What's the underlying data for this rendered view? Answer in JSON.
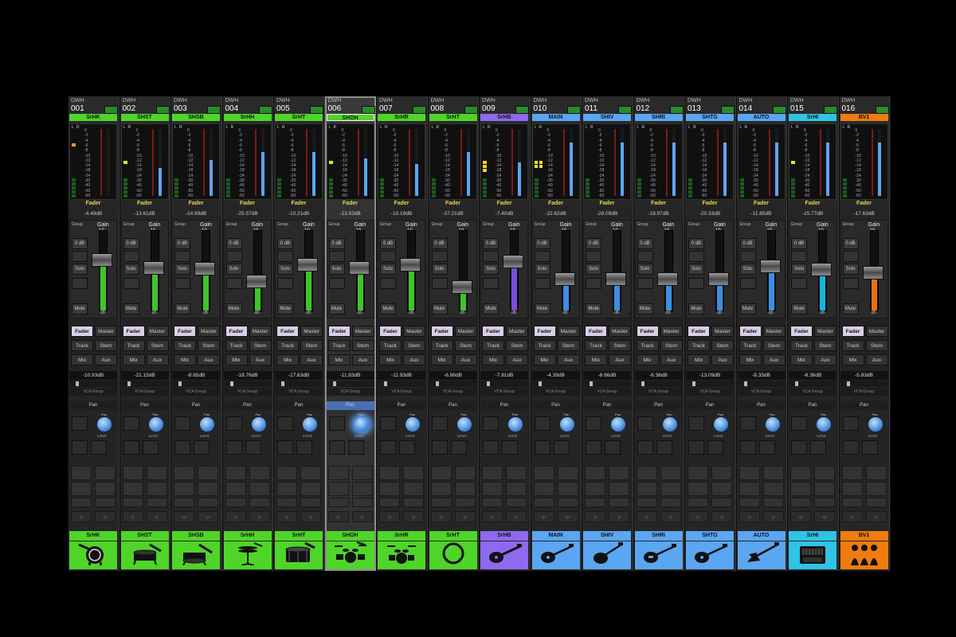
{
  "labels": {
    "dwh": "DWH",
    "fader": "Fader",
    "group": "Group",
    "gain": "Gain",
    "gain_scale_top": "10",
    "gain_scale_mark": "0",
    "zero_db": "0 dB",
    "solo": "Solo",
    "mute": "Mute",
    "db": "dB",
    "fader_btn": "Fader",
    "master_btn": "Master",
    "track_btn": "Track",
    "stem_btn": "Stem",
    "mix_btn": "Mix",
    "aux_btn": "Aux",
    "vca_group": "VCA Group",
    "pan": "Pan",
    "pan_knob_label": "Pan",
    "vpot": "V-POT",
    "meter_l": "L",
    "meter_r": "R",
    "scale": [
      "0",
      "-2",
      "-4",
      "-6",
      "-8",
      "-10",
      "-12",
      "-14",
      "-18",
      "-24",
      "-30",
      "-40",
      "-50",
      "-60"
    ]
  },
  "colors": {
    "green": "#4fd42a",
    "purple": "#8f69f0",
    "blue": "#5aa6f2",
    "cyan": "#2fc3e6",
    "orange": "#f07c10",
    "fill_green": "#3fc52a",
    "fill_purple": "#7a4de0",
    "fill_blue": "#3d8ee0",
    "fill_cyan": "#15b5dc",
    "fill_orange": "#e87010"
  },
  "channels": [
    {
      "num": "001",
      "name": "SrHK",
      "color": "green",
      "fader_db": "-4.49dB",
      "level": 0.64,
      "meter": 0.0,
      "peak": "orange",
      "mix_db": "-10.93dB",
      "icon": "kick-drum-icon"
    },
    {
      "num": "002",
      "name": "SHST",
      "color": "green",
      "fader_db": "-13.61dB",
      "level": 0.54,
      "meter": 0.42,
      "peak": "yellow",
      "mix_db": "-21.15dB",
      "icon": "snare-drum-icon"
    },
    {
      "num": "003",
      "name": "SHSB",
      "color": "green",
      "fader_db": "-14.99dB",
      "level": 0.53,
      "meter": 0.54,
      "peak": "",
      "mix_db": "-8.65dB",
      "icon": "snare-bottom-icon"
    },
    {
      "num": "004",
      "name": "SrHH",
      "color": "green",
      "fader_db": "-25.57dB",
      "level": 0.37,
      "meter": 0.66,
      "peak": "",
      "mix_db": "-18.76dB",
      "icon": "hihat-icon"
    },
    {
      "num": "005",
      "name": "SrHT",
      "color": "green",
      "fader_db": "-10.21dB",
      "level": 0.58,
      "meter": 0.66,
      "peak": "",
      "mix_db": "-17.63dB",
      "icon": "tom-drum-icon"
    },
    {
      "num": "006",
      "name": "SHOH",
      "color": "green",
      "fader_db": "-13.53dB",
      "level": 0.54,
      "meter": 0.56,
      "peak": "yellow",
      "mix_db": "-11.83dB",
      "icon": "drum-kit-icon",
      "selected": true
    },
    {
      "num": "007",
      "name": "SrHR",
      "color": "green",
      "fader_db": "-10.19dB",
      "level": 0.58,
      "meter": 0.48,
      "peak": "",
      "mix_db": "-11.93dB",
      "icon": "drum-kit-room-icon"
    },
    {
      "num": "008",
      "name": "SrHT",
      "color": "green",
      "fader_db": "-37.21dB",
      "level": 0.3,
      "meter": 0.66,
      "peak": "",
      "mix_db": "-6.86dB",
      "icon": "tambourine-icon"
    },
    {
      "num": "009",
      "name": "SrHB",
      "color": "purple",
      "fader_db": "-7.40dB",
      "level": 0.62,
      "meter": 0.5,
      "peak": "yellow2",
      "mix_db": "-7.81dB",
      "icon": "bass-guitar-icon"
    },
    {
      "num": "010",
      "name": "MAIN",
      "color": "blue",
      "fader_db": "-22.62dB",
      "level": 0.4,
      "meter": 0.8,
      "peak": "yellow3",
      "mix_db": "-4.39dB",
      "icon": "electric-guitar-icon"
    },
    {
      "num": "011",
      "name": "SHIV",
      "color": "blue",
      "fader_db": "-28.09dB",
      "level": 0.4,
      "meter": 0.8,
      "peak": "",
      "mix_db": "-8.66dB",
      "icon": "guitar-icon"
    },
    {
      "num": "012",
      "name": "SHRI",
      "color": "blue",
      "fader_db": "-19.97dB",
      "level": 0.4,
      "meter": 0.8,
      "peak": "",
      "mix_db": "-6.36dB",
      "icon": "guitar-2-icon"
    },
    {
      "num": "013",
      "name": "SHTG",
      "color": "blue",
      "fader_db": "-20.33dB",
      "level": 0.4,
      "meter": 0.8,
      "peak": "",
      "mix_db": "-13.09dB",
      "icon": "guitar-3-icon"
    },
    {
      "num": "014",
      "name": "AUTO",
      "color": "blue",
      "fader_db": "-11.65dB",
      "level": 0.56,
      "meter": 0.8,
      "peak": "",
      "mix_db": "-8.33dB",
      "icon": "flying-v-guitar-icon"
    },
    {
      "num": "015",
      "name": "SrHI",
      "color": "cyan",
      "fader_db": "-15.77dB",
      "level": 0.52,
      "meter": 0.8,
      "peak": "yellow",
      "mix_db": "-6.36dB",
      "icon": "keyboard-amp-icon"
    },
    {
      "num": "016",
      "name": "BV1",
      "color": "orange",
      "fader_db": "-17.63dB",
      "level": 0.48,
      "meter": 0.8,
      "peak": "",
      "mix_db": "-5.83dB",
      "icon": "backing-vocals-icon"
    }
  ]
}
